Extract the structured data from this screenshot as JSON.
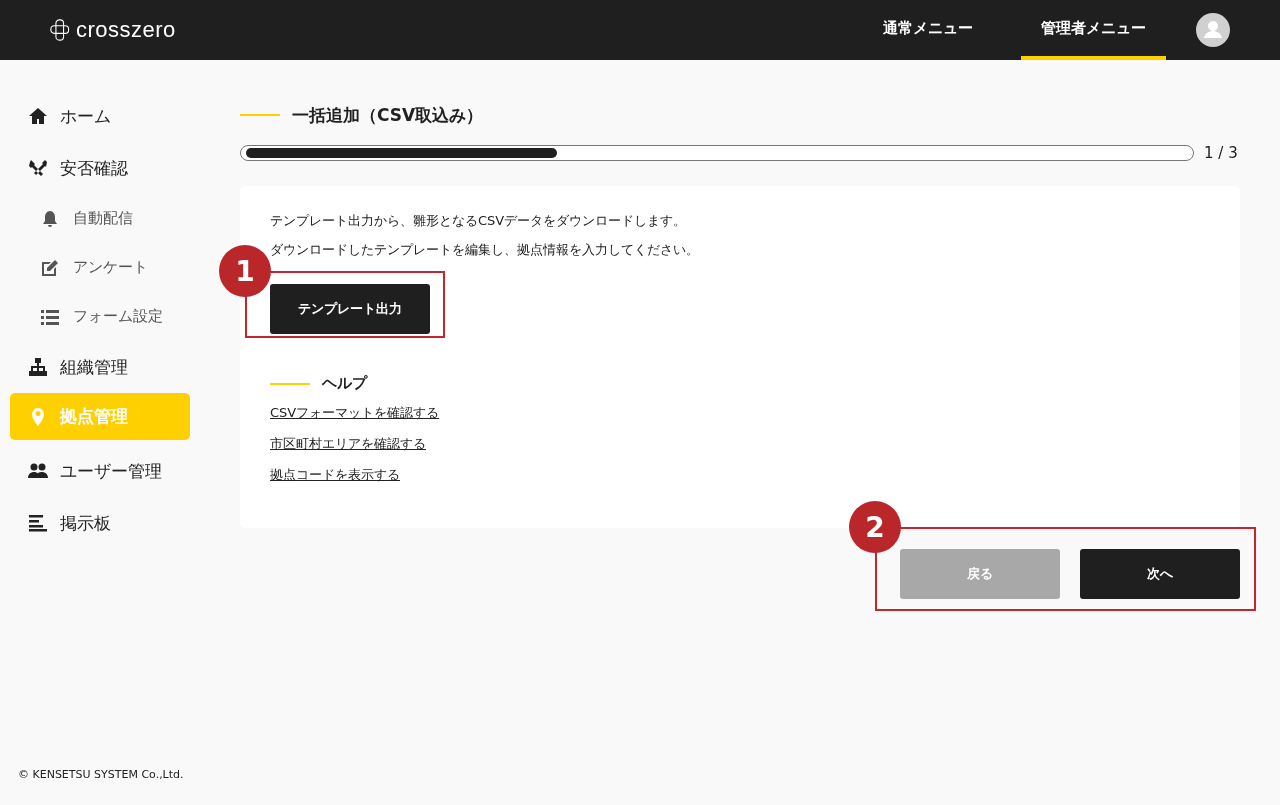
{
  "header": {
    "logo": "crosszero",
    "menu": [
      {
        "label": "通常メニュー",
        "selected": false
      },
      {
        "label": "管理者メニュー",
        "selected": true
      }
    ]
  },
  "sidebar": {
    "items": [
      {
        "label": "ホーム",
        "kind": "main",
        "selected": false
      },
      {
        "label": "安否確認",
        "kind": "main",
        "selected": false
      },
      {
        "label": "自動配信",
        "kind": "sub",
        "selected": false
      },
      {
        "label": "アンケート",
        "kind": "sub",
        "selected": false
      },
      {
        "label": "フォーム設定",
        "kind": "sub",
        "selected": false
      },
      {
        "label": "組織管理",
        "kind": "main",
        "selected": false
      },
      {
        "label": "拠点管理",
        "kind": "main",
        "selected": true
      },
      {
        "label": "ユーザー管理",
        "kind": "main",
        "selected": false
      },
      {
        "label": "掲示板",
        "kind": "main",
        "selected": false
      }
    ]
  },
  "page": {
    "title": "一括追加（CSV取込み）",
    "progress": {
      "level": 0.33,
      "reading": "1 / 3"
    },
    "card": {
      "lines": [
        "テンプレート出力から、雛形となるCSVデータをダウンロードします。",
        "ダウンロードしたテンプレートを編集し、拠点情報を入力してください。"
      ],
      "button": "テンプレート出力",
      "help": {
        "title": "ヘルプ",
        "links": [
          "CSVフォーマットを確認する",
          "市区町村エリアを確認する",
          "拠点コードを表示する"
        ]
      }
    },
    "buttons": [
      {
        "label": "戻る",
        "disabled": true
      },
      {
        "label": "次へ",
        "disabled": false
      }
    ]
  },
  "annotations": [
    {
      "number": "1"
    },
    {
      "number": "2"
    }
  ],
  "footer": "© KENSETSU SYSTEM Co.,Ltd."
}
